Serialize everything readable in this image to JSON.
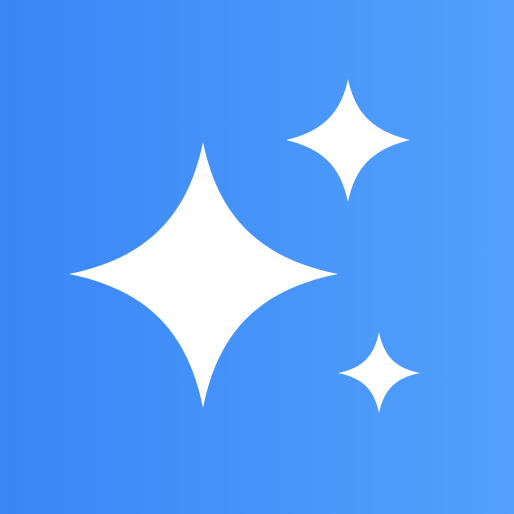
{
  "icon": {
    "name": "sparkles-icon",
    "gradient_start": "#3A86F7",
    "gradient_end": "#52A1FB",
    "glyph_color": "#FFFFFF"
  }
}
